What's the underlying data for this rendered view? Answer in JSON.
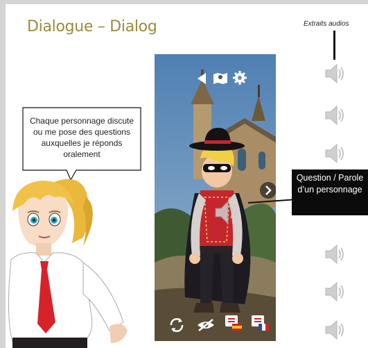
{
  "slide": {
    "title": "Dialogue – Dialog",
    "audio_caption": "Extraits audios",
    "bubble_text": "Chaque personnage discute ou me pose des questions auxquelles je réponds oralement",
    "question_box": "Question / Parole d’un personnage",
    "audio_icon_count": 7
  },
  "phone": {
    "top_icons": [
      "back-arrow-icon",
      "map-icon",
      "settings-gear-icon"
    ],
    "bottom_icons": [
      "refresh-icon",
      "hide-eye-icon",
      "language-flag-es-icon",
      "language-flag-fr-icon"
    ],
    "side_button": "chevron-right-icon"
  },
  "colors": {
    "title": "#9c8a3c",
    "question_box_bg": "#0b0b0b",
    "speaker_icon": "#c9c9c9"
  }
}
